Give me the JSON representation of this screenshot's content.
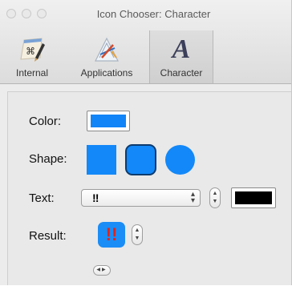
{
  "window": {
    "title": "Icon Chooser: Character"
  },
  "toolbar": {
    "items": [
      {
        "label": "Internal",
        "icon": "command-key-pen-icon",
        "selected": false
      },
      {
        "label": "Applications",
        "icon": "applications-folder-icon",
        "selected": false
      },
      {
        "label": "Character",
        "icon": "letter-a-icon",
        "icon_glyph": "A",
        "selected": true
      }
    ]
  },
  "form": {
    "color_label": "Color:",
    "color_value": "#1184f7",
    "shape_label": "Shape:",
    "shapes": [
      "square",
      "rounded-square",
      "circle"
    ],
    "selected_shape": "rounded-square",
    "text_label": "Text:",
    "text_value": "‼",
    "text_color_value": "#000000",
    "result_label": "Result:",
    "result_glyph": "!!"
  },
  "colors": {
    "accent": "#1388f8",
    "result_glyph": "#e0241c"
  }
}
